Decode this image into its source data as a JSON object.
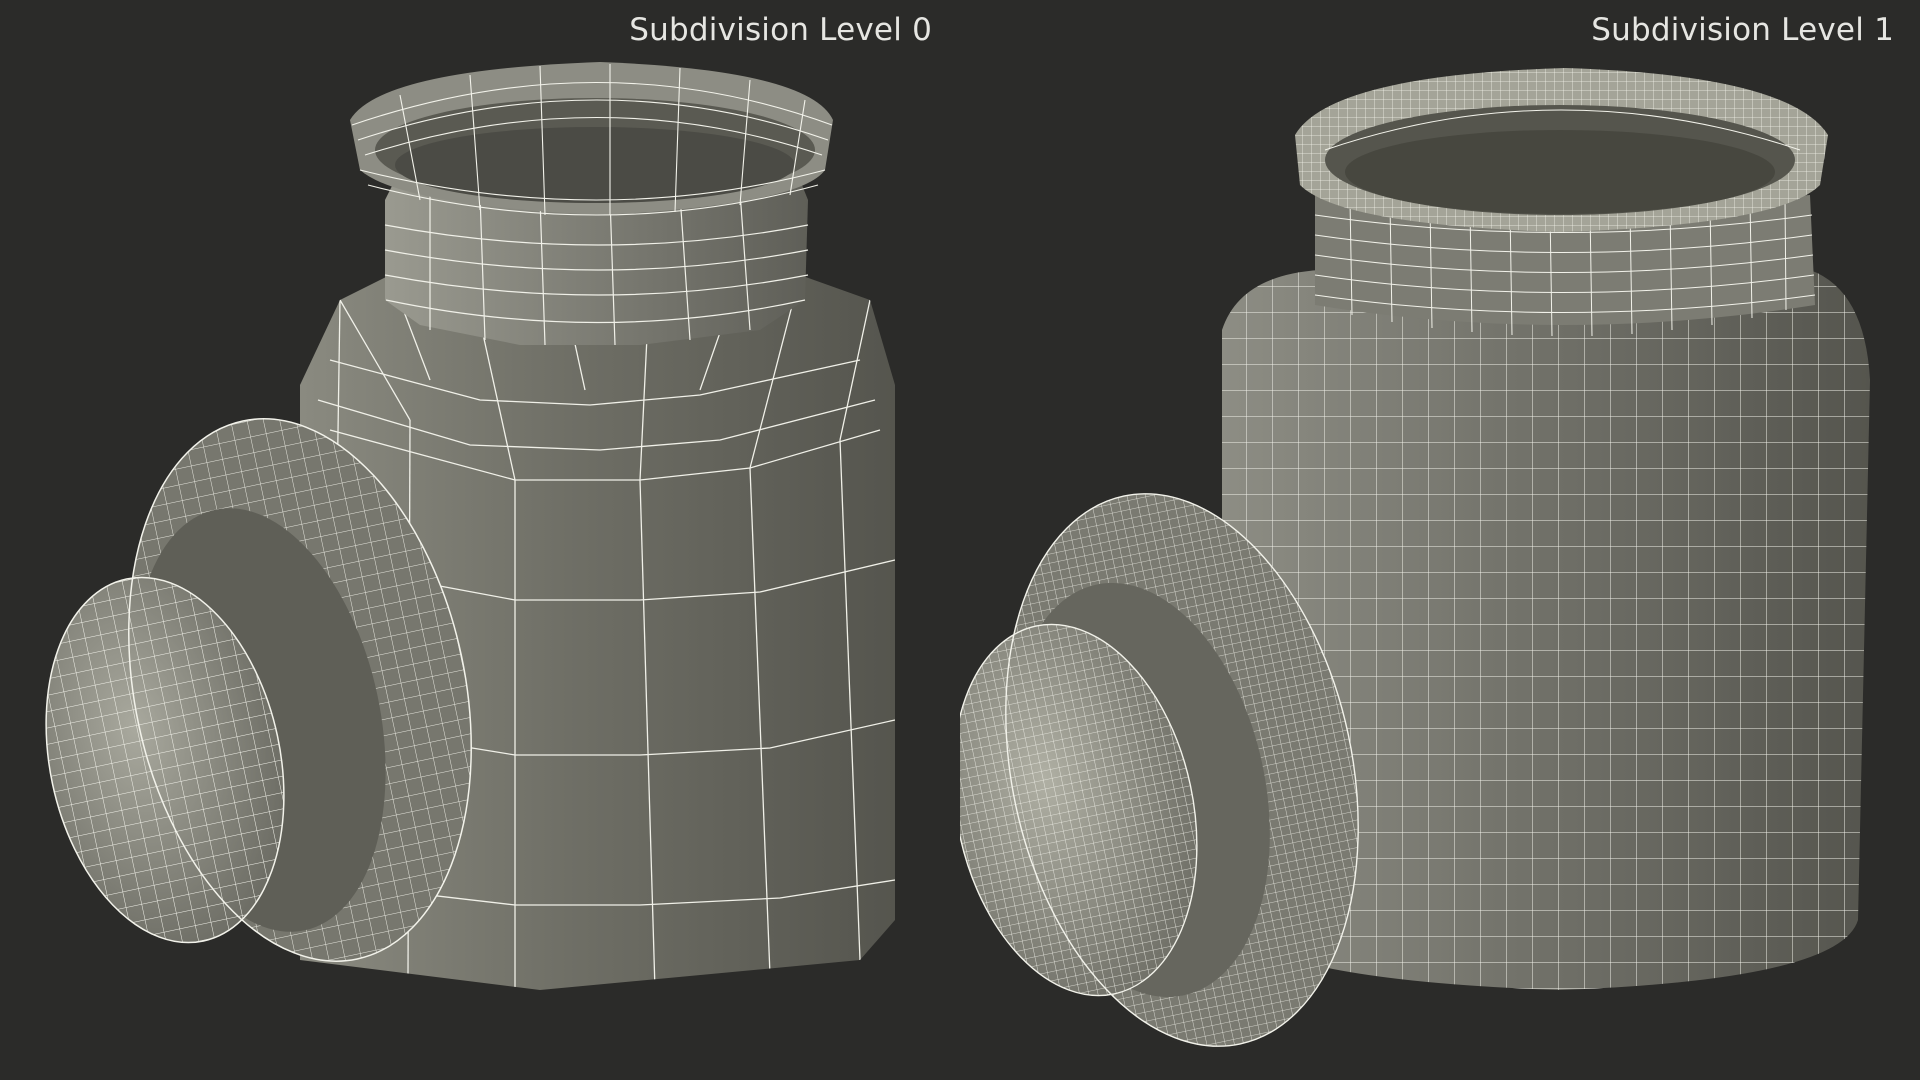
{
  "panels": [
    {
      "label": "Subdivision Level 0",
      "subdivision": 0
    },
    {
      "label": "Subdivision Level 1",
      "subdivision": 1
    }
  ],
  "colors": {
    "background": "#2b2b29",
    "surface": "#7a7a70",
    "wire": "#f2f2ea",
    "label": "#e6e6e2"
  }
}
